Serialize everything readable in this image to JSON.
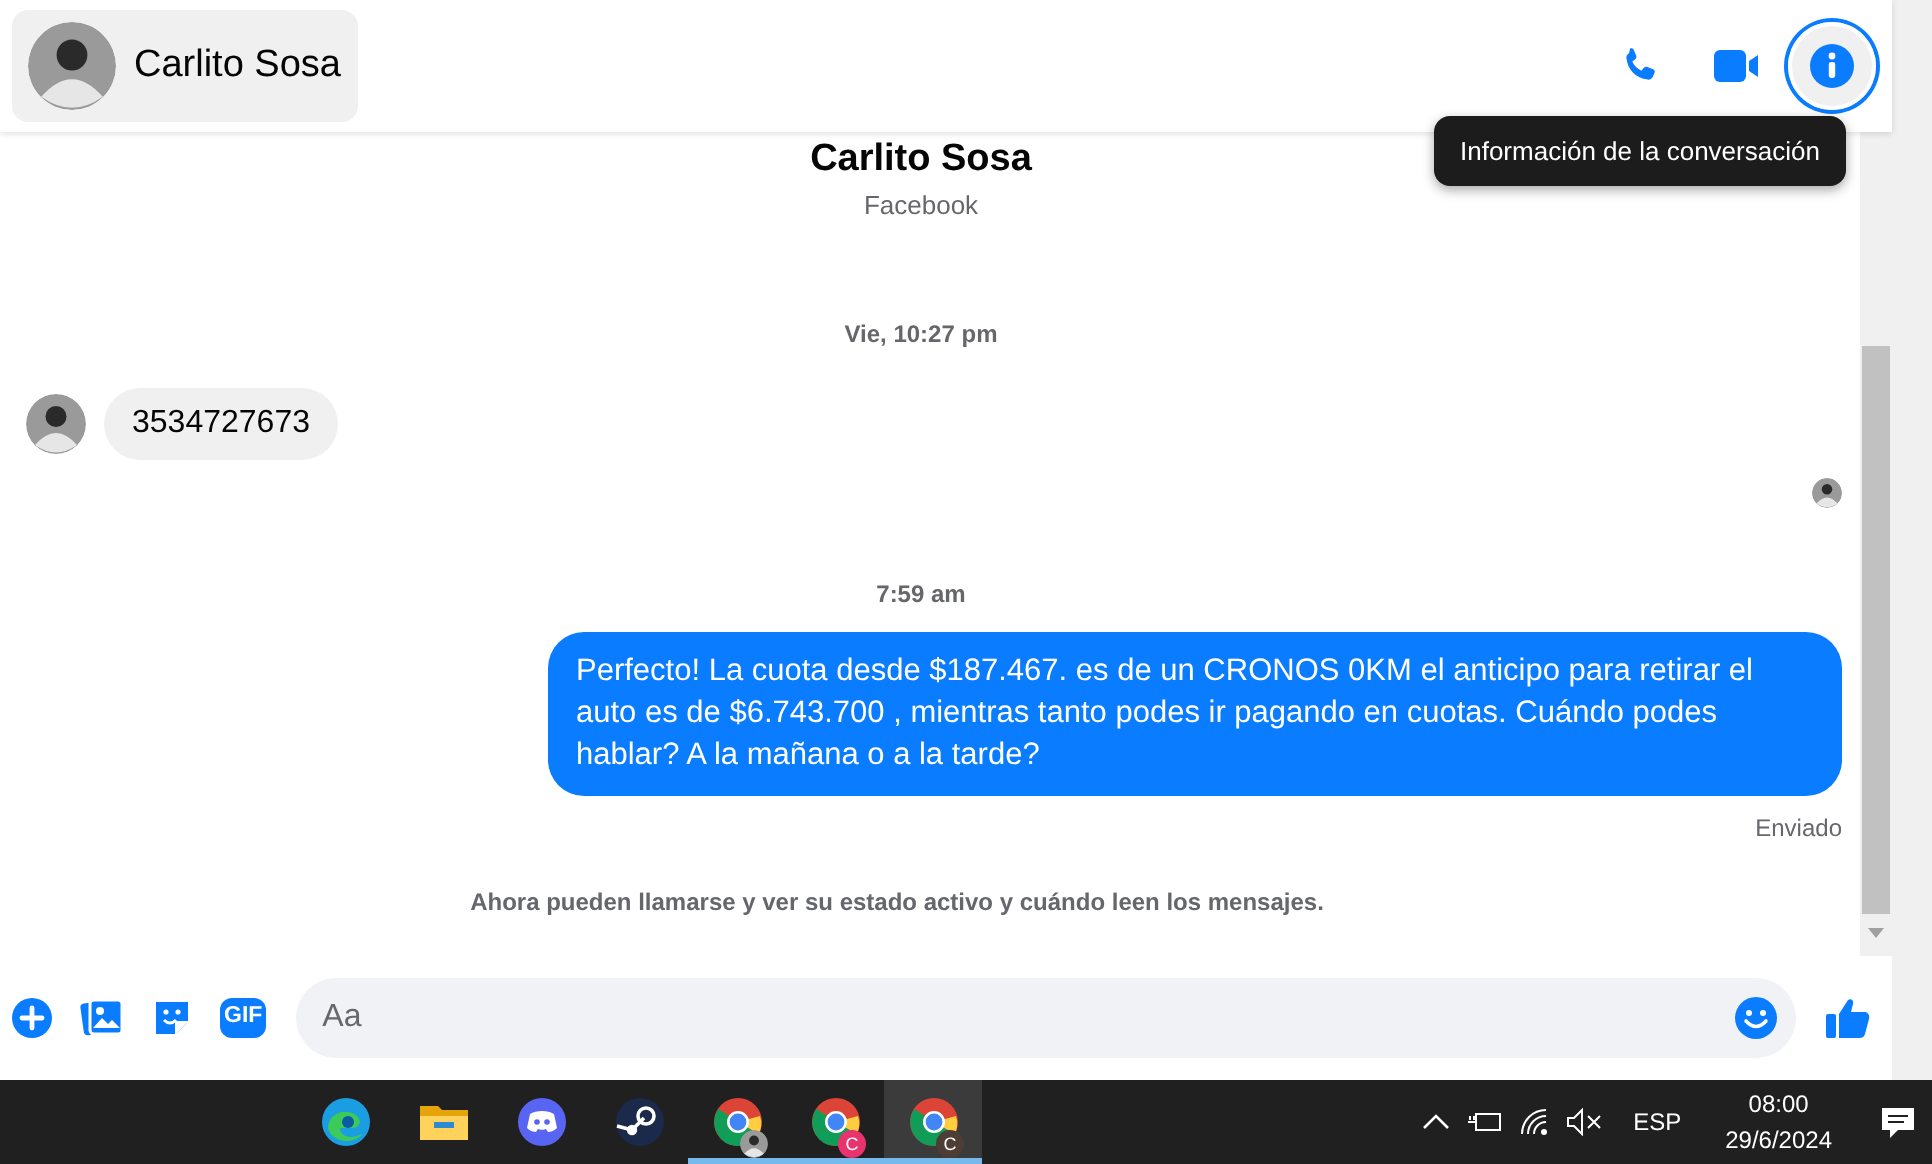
{
  "header": {
    "name": "Carlito Sosa",
    "actions": [
      {
        "kind": "phone",
        "selected": false
      },
      {
        "kind": "video",
        "selected": false
      },
      {
        "kind": "info",
        "selected": true
      }
    ]
  },
  "tooltip": "Información de la conversación",
  "profile": {
    "name": "Carlito Sosa",
    "source": "Facebook"
  },
  "messages": [
    {
      "kind": "time",
      "text": "Vie, 10:27 pm"
    },
    {
      "kind": "received",
      "text": "3534727673"
    },
    {
      "kind": "seen"
    },
    {
      "kind": "time",
      "text": "7:59 am"
    },
    {
      "kind": "sent",
      "text": "Perfecto! La cuota desde $187.467. es de un CRONOS 0KM el anticipo para retirar el auto es de $6.743.700 , mientras tanto podes ir pagando en cuotas. Cuándo podes hablar? A la mañana o a la tarde?",
      "status": "Enviado"
    },
    {
      "kind": "notice",
      "text": "Ahora pueden llamarse y ver su estado activo y cuándo leen los mensajes."
    }
  ],
  "composer": {
    "tools": [
      {
        "kind": "plus"
      },
      {
        "kind": "image"
      },
      {
        "kind": "sticker"
      },
      {
        "kind": "gif",
        "label": "GIF"
      }
    ],
    "placeholder": "Aa"
  },
  "taskbar": {
    "apps": [
      {
        "kind": "edge",
        "running": false,
        "active": false
      },
      {
        "kind": "folder",
        "running": false,
        "active": false
      },
      {
        "kind": "discord",
        "running": false,
        "active": false
      },
      {
        "kind": "steam",
        "running": false,
        "active": false
      },
      {
        "kind": "chrome",
        "running": true,
        "active": false,
        "badge": {
          "kind": "photo"
        }
      },
      {
        "kind": "chrome",
        "running": true,
        "active": false,
        "badge": {
          "kind": "letter",
          "text": "C",
          "color": "#e8336e"
        }
      },
      {
        "kind": "chrome",
        "running": true,
        "active": true,
        "badge": {
          "kind": "letter",
          "text": "C",
          "color": "#4e3d35"
        }
      }
    ],
    "language": "ESP",
    "time": "08:00",
    "date": "29/6/2024"
  }
}
